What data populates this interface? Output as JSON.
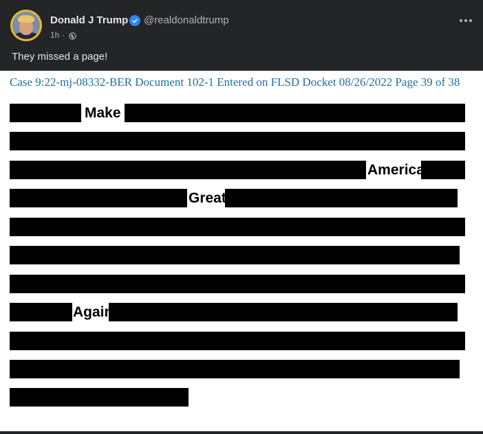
{
  "post": {
    "author_name": "Donald J Trump",
    "author_handle": "@realdonaldtrump",
    "timestamp": "1h",
    "separator": "·",
    "audience_icon": "globe-icon",
    "verified_icon": "verified-badge-icon",
    "menu_icon": "more-options-icon",
    "caption": "They missed a page!"
  },
  "document": {
    "header": "Case 9:22-mj-08332-BER Document 102-1 Entered on FLSD Docket 08/26/2022 Page 39 of 38",
    "visible_words": [
      "Make",
      "America",
      "Great",
      "Again"
    ],
    "redaction_color": "#000000"
  },
  "colors": {
    "background": "#242526",
    "primary_text": "#e4e6eb",
    "secondary_text": "#b0b3b8",
    "verified": "#2d88ff",
    "doc_header": "#1f6ea6"
  }
}
